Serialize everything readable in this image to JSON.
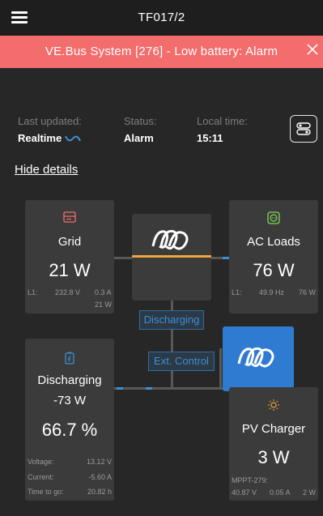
{
  "header": {
    "title": "TF017/2"
  },
  "alarm": {
    "text": "VE.Bus System [276] - Low battery: Alarm"
  },
  "info": {
    "last_updated_label": "Last updated:",
    "last_updated_value": "Realtime",
    "status_label": "Status:",
    "status_value": "Alarm",
    "local_time_label": "Local time:",
    "local_time_value": "15:11"
  },
  "hide_details": "Hide details",
  "grid": {
    "title": "Grid",
    "value": "21 W",
    "l1_label": "L1:",
    "voltage": "232.8 V",
    "current": "0.3 A",
    "power": "21 W"
  },
  "ac_loads": {
    "title": "AC Loads",
    "value": "76 W",
    "l1_label": "L1:",
    "frequency": "49.9 Hz",
    "power": "76 W"
  },
  "tags": {
    "discharging": "Discharging",
    "ext_control": "Ext. Control"
  },
  "battery": {
    "state": "Discharging",
    "power": "-73 W",
    "soc": "66.7 %",
    "voltage_label": "Voltage:",
    "voltage_value": "13.12 V",
    "current_label": "Current:",
    "current_value": "-5.60 A",
    "ttg_label": "Time to go:",
    "ttg_value": "20.82 h"
  },
  "pv": {
    "title": "PV Charger",
    "value": "3 W",
    "device": "MPPT-279:",
    "voltage": "40.87 V",
    "current": "0.05 A",
    "power": "2 W"
  },
  "colors": {
    "alarm": "#f46d6d",
    "accent_blue": "#3d8fd3",
    "flow_orange": "#f0a43a",
    "grid_red": "#f46d6d",
    "load_green": "#7ed957"
  }
}
